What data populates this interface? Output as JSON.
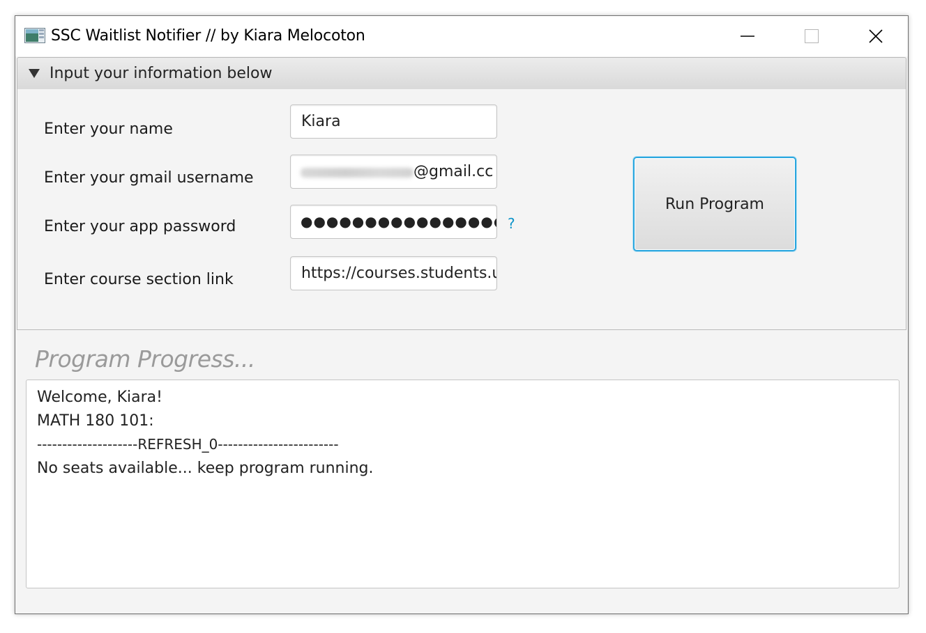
{
  "window": {
    "title": "SSC Waitlist Notifier // by Kiara Melocoton"
  },
  "input_pane": {
    "header": "Input your information below",
    "fields": [
      {
        "label": "Enter your name",
        "value": "Kiara"
      },
      {
        "label": "Enter your gmail username",
        "value_suffix": "@gmail.cc"
      },
      {
        "label": "Enter your app password",
        "masked_value": "●●●●●●●●●●●●●●●●",
        "help": "?"
      },
      {
        "label": "Enter course section link",
        "value": "https://courses.students.u"
      }
    ],
    "run_button": "Run Program"
  },
  "progress": {
    "title": "Program Progress...",
    "log_lines": [
      "Welcome, Kiara!",
      "MATH 180 101:",
      "--------------------REFRESH_0------------------------",
      "No seats available... keep program running."
    ]
  },
  "colors": {
    "accent": "#2aa6de",
    "help_link": "#0b93c9",
    "window_bg": "#f4f4f4"
  }
}
